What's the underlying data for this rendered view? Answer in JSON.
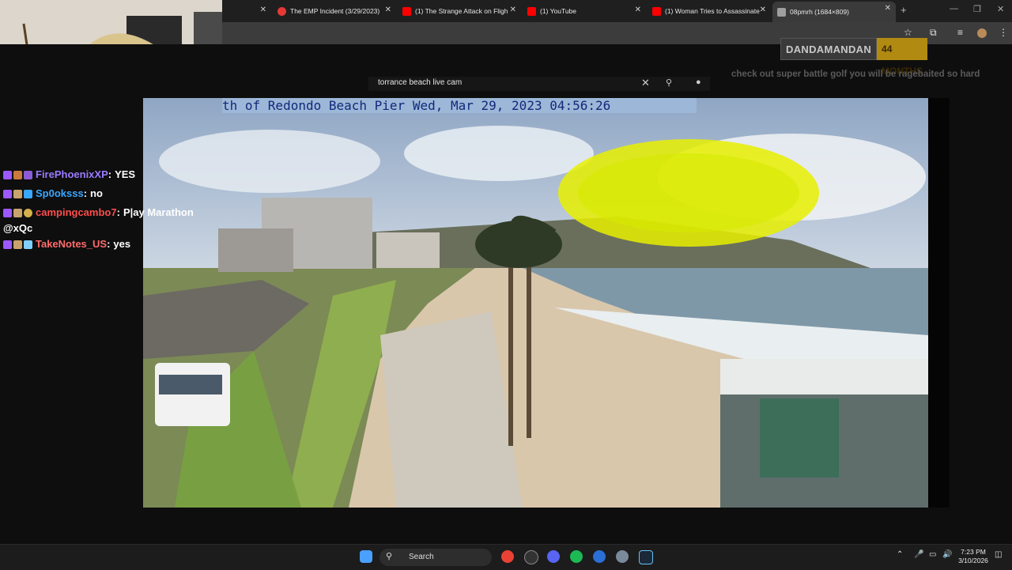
{
  "browser": {
    "tabs": [
      {
        "label": "The EMP Incident (3/29/2023)",
        "color": "#e53935"
      },
      {
        "label": "(1) The Strange Attack on Fligh",
        "color": "#ff0000"
      },
      {
        "label": "(1) YouTube",
        "color": "#ff0000"
      },
      {
        "label": "(1) Woman Tries to Assassinate",
        "color": "#ff0000"
      },
      {
        "label": "08pmrh (1684×809)",
        "color": "#9e9e9e"
      }
    ]
  },
  "search": {
    "value": "torrance beach live cam"
  },
  "video": {
    "overlay_text": "th of Redondo Beach Pier  Wed, Mar 29, 2023 04:56:26"
  },
  "chat": {
    "messages": [
      {
        "user": "FirePhoenixXP",
        "user_color": "#9b7bff",
        "text": "YES"
      },
      {
        "user": "Sp0oksss",
        "user_color": "#3aa7ff",
        "text": "no"
      },
      {
        "user": "campingcambo7",
        "user_color": "#ff4d4d",
        "text": "P|ay Marathon",
        "continuation": "@xQc"
      },
      {
        "user": "TakeNotes_US",
        "user_color": "#ff6b6b",
        "text": "yes"
      }
    ]
  },
  "sub": {
    "name": "DANDAMANDAN",
    "months": "44 MONTHS"
  },
  "promo_text": "check out super battle golf you will be ragebaited so hard",
  "taskbar": {
    "search_label": "Search",
    "time": "7:23 PM",
    "date": "3/10/2026"
  }
}
